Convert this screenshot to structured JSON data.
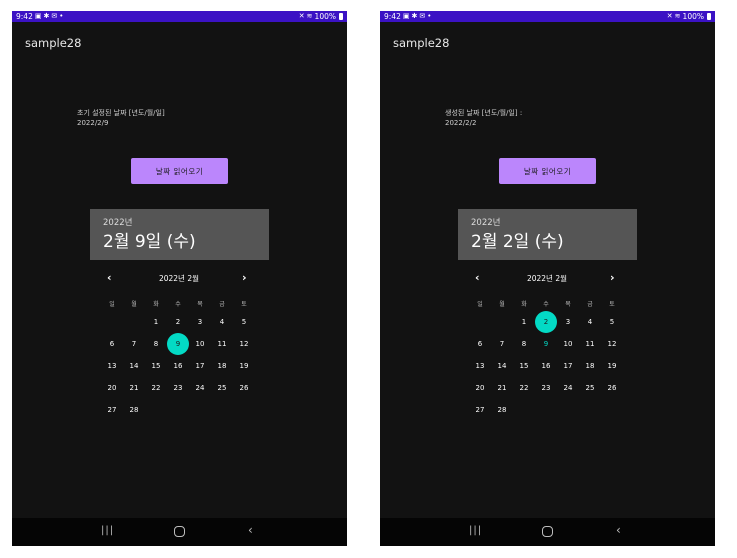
{
  "screens": [
    {
      "status": {
        "time": "9:42",
        "battery": "100%"
      },
      "app_title": "sample28",
      "info_label": "초기 설정된 날짜 [년도/월/일]",
      "info_date": "2022/2/9",
      "button_label": "날짜 읽어오기",
      "picker": {
        "header_year": "2022년",
        "header_date": "2월 9일 (수)",
        "month_label": "2022년 2월",
        "prev_icon": "‹",
        "next_icon": "›",
        "selected_day": "9",
        "today_day": "9"
      }
    },
    {
      "status": {
        "time": "9:42",
        "battery": "100%"
      },
      "app_title": "sample28",
      "info_label": "생성된 날짜 [년도/월/일] :",
      "info_date": "2022/2/2",
      "button_label": "날짜 읽어오기",
      "picker": {
        "header_year": "2022년",
        "header_date": "2월 2일 (수)",
        "month_label": "2022년 2월",
        "prev_icon": "‹",
        "next_icon": "›",
        "selected_day": "2",
        "today_day": "9"
      }
    }
  ],
  "weekdays": [
    "일",
    "월",
    "화",
    "수",
    "목",
    "금",
    "토"
  ],
  "calendar_first_weekday": 2,
  "calendar_days": [
    "1",
    "2",
    "3",
    "4",
    "5",
    "6",
    "7",
    "8",
    "9",
    "10",
    "11",
    "12",
    "13",
    "14",
    "15",
    "16",
    "17",
    "18",
    "19",
    "20",
    "21",
    "22",
    "23",
    "24",
    "25",
    "26",
    "27",
    "28"
  ],
  "nav": {
    "recent_icon": "|||",
    "back_icon": "‹"
  },
  "colors": {
    "status_bar": "#3b12c4",
    "background": "#121212",
    "button": "#bb86fc",
    "picker_header": "#555555",
    "accent": "#03dac5",
    "nav_bar": "#050505"
  }
}
